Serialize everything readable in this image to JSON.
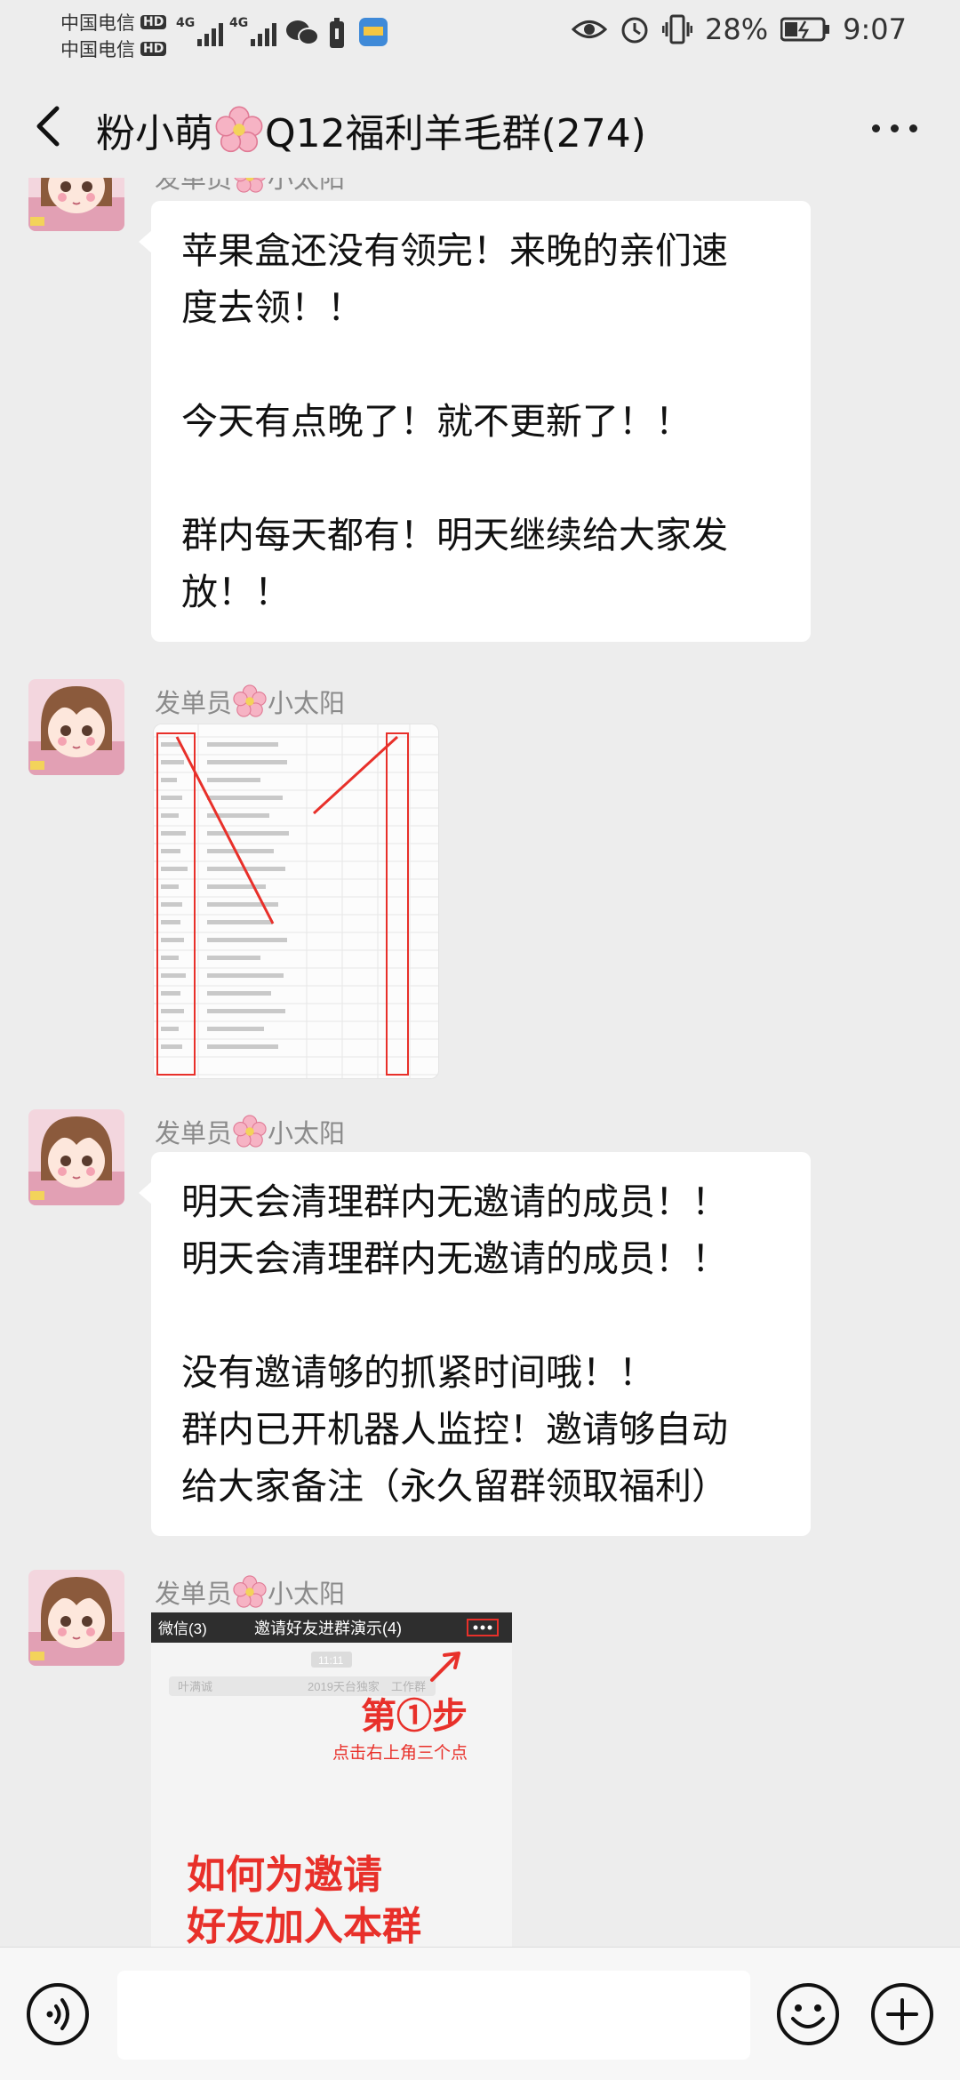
{
  "status_bar": {
    "carrier1": "中国电信",
    "carrier2": "中国电信",
    "hd": "HD",
    "network": "4G",
    "battery": "28%",
    "time": "9:07"
  },
  "header": {
    "title_part1": "粉小萌",
    "title_part2": "Q12福利羊毛群(274)"
  },
  "messages": [
    {
      "sender_part1": "发单员",
      "sender_part2": "小太阳",
      "text": "苹果盒还没有领完！来晚的亲们速\n度去领！！\n\n今天有点晚了！就不更新了！！\n\n群内每天都有！明天继续给大家发\n放！！"
    },
    {
      "sender_part1": "发单员",
      "sender_part2": "小太阳"
    },
    {
      "sender_part1": "发单员",
      "sender_part2": "小太阳",
      "text": "明天会清理群内无邀请的成员！！\n明天会清理群内无邀请的成员！！\n\n没有邀请够的抓紧时间哦！！\n群内已开机器人监控！邀请够自动\n给大家备注（永久留群领取福利）"
    },
    {
      "sender_part1": "发单员",
      "sender_part2": "小太阳",
      "image": {
        "back_label": "微信(3)",
        "title": "邀请好友进群演示(4)",
        "time": "11:11",
        "row_name": "叶满诚",
        "row_text": "2019天台独家",
        "row_text2": "工作群",
        "step": "第①步",
        "hint": "点击右上角三个点",
        "caption_line1": "如何为邀请",
        "caption_line2": "好友加入本群"
      }
    }
  ],
  "colors": {
    "background": "#ededed",
    "bubble": "#ffffff",
    "sender_text": "#8a8a8a",
    "accent_red": "#e8302a"
  },
  "icons": {
    "back": "chevron-left-icon",
    "more": "more-dots-icon",
    "voice": "voice-icon",
    "emoji": "emoji-icon",
    "plus": "plus-icon"
  }
}
